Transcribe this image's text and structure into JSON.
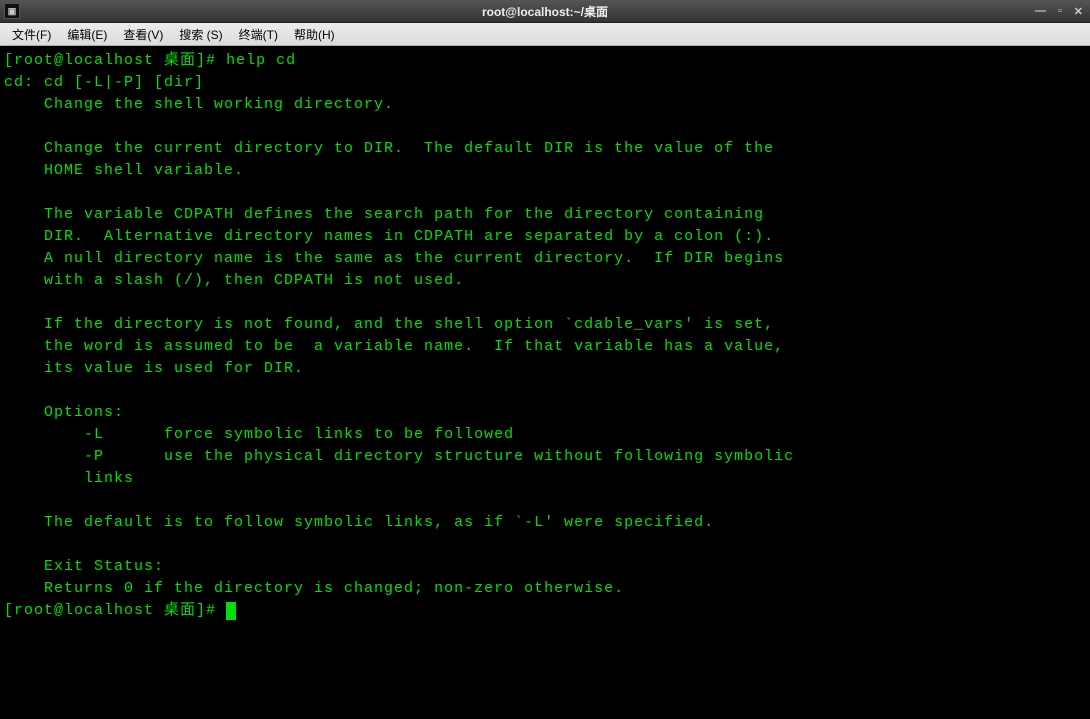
{
  "titlebar": {
    "title": "root@localhost:~/桌面",
    "icon": "▣"
  },
  "menubar": {
    "items": [
      "文件(F)",
      "编辑(E)",
      "查看(V)",
      "搜索 (S)",
      "终端(T)",
      "帮助(H)"
    ]
  },
  "terminal": {
    "prompt1_open": "[",
    "prompt1_user": "root@localhost 桌面",
    "prompt1_close": "]# ",
    "command": "help cd",
    "output": "cd: cd [-L|-P] [dir]\n    Change the shell working directory.\n    \n    Change the current directory to DIR.  The default DIR is the value of the\n    HOME shell variable.\n    \n    The variable CDPATH defines the search path for the directory containing\n    DIR.  Alternative directory names in CDPATH are separated by a colon (:).\n    A null directory name is the same as the current directory.  If DIR begins\n    with a slash (/), then CDPATH is not used.\n    \n    If the directory is not found, and the shell option `cdable_vars' is set,\n    the word is assumed to be  a variable name.  If that variable has a value,\n    its value is used for DIR.\n    \n    Options:\n        -L      force symbolic links to be followed\n        -P      use the physical directory structure without following symbolic\n        links\n    \n    The default is to follow symbolic links, as if `-L' were specified.\n    \n    Exit Status:\n    Returns 0 if the directory is changed; non-zero otherwise.",
    "prompt2_open": "[",
    "prompt2_user": "root@localhost 桌面",
    "prompt2_close": "]# "
  }
}
